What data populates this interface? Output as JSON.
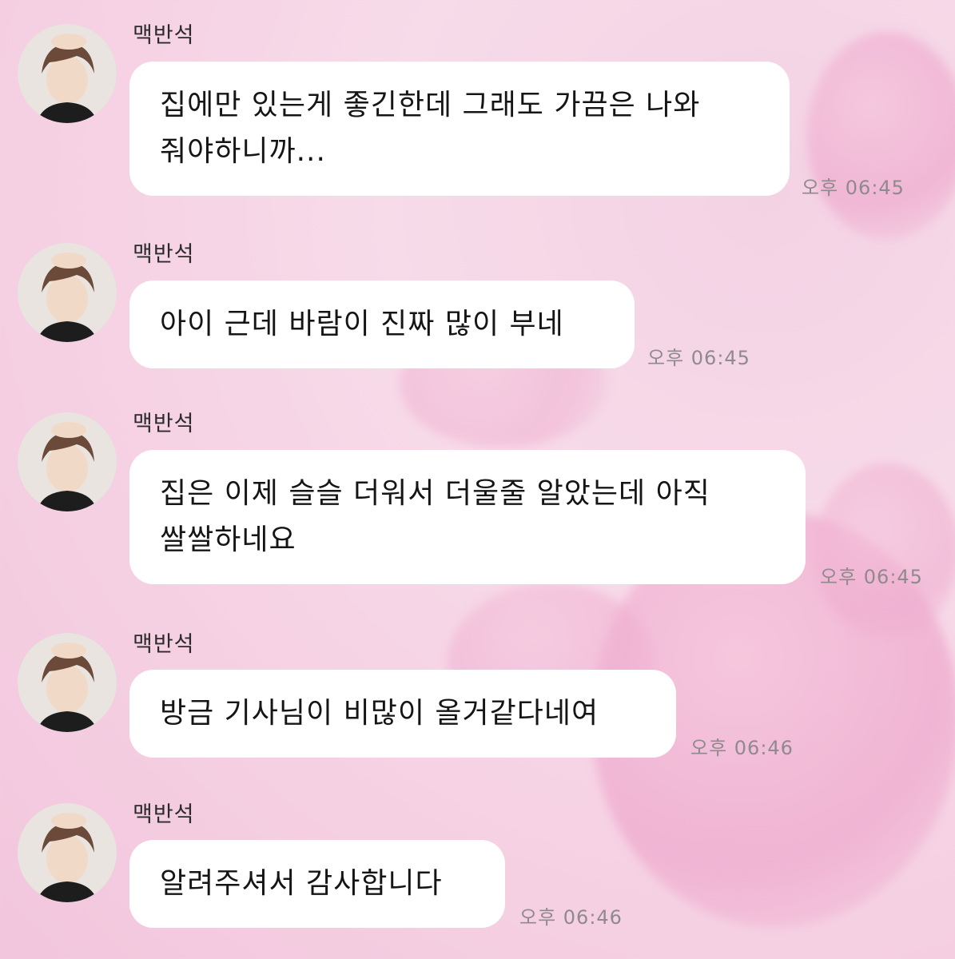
{
  "messages": [
    {
      "sender": "맥반석",
      "lines": [
        "집에만 있는게 좋긴한데 그래도 가끔은 나와",
        "줘야하니까..."
      ],
      "time": "오후 06:45"
    },
    {
      "sender": "맥반석",
      "lines": [
        "아이 근데 바람이 진짜 많이 부네"
      ],
      "time": "오후 06:45"
    },
    {
      "sender": "맥반석",
      "lines": [
        "집은 이제 슬슬 더워서 더울줄 알았는데 아직",
        "쌀쌀하네요"
      ],
      "time": "오후 06:45"
    },
    {
      "sender": "맥반석",
      "lines": [
        "방금 기사님이 비많이 올거같다네여"
      ],
      "time": "오후 06:46"
    },
    {
      "sender": "맥반석",
      "lines": [
        "알려주셔서 감사합니다"
      ],
      "time": "오후 06:46"
    }
  ],
  "avatar_icon": "profile-photo-icon",
  "colors": {
    "bubble": "#ffffff",
    "background": "#f5d3e5",
    "time_text": "#8f8a8d"
  }
}
